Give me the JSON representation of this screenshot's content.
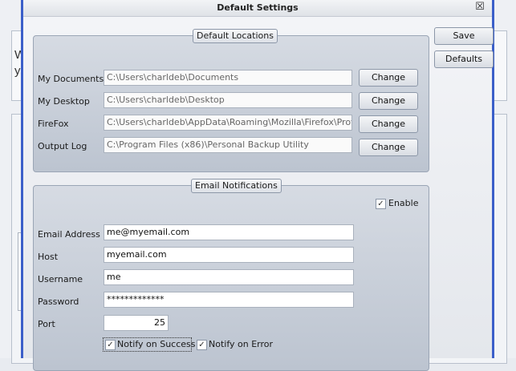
{
  "background": {
    "line1": "W",
    "line2": "y"
  },
  "dialog": {
    "title": "Default Settings",
    "close_glyph": "☒"
  },
  "side_buttons": {
    "save": "Save",
    "defaults": "Defaults"
  },
  "default_locations": {
    "title": "Default Locations",
    "change_label": "Change",
    "rows": [
      {
        "label": "My Documents",
        "value": "C:\\Users\\charldeb\\Documents"
      },
      {
        "label": "My Desktop",
        "value": "C:\\Users\\charldeb\\Desktop"
      },
      {
        "label": "FireFox",
        "value": "C:\\Users\\charldeb\\AppData\\Roaming\\Mozilla\\Firefox\\Profile"
      },
      {
        "label": "Output Log",
        "value": "C:\\Program Files (x86)\\Personal Backup Utility"
      }
    ]
  },
  "email": {
    "title": "Email Notifications",
    "enable_label": "Enable",
    "enable_checked": true,
    "fields": {
      "email_address": {
        "label": "Email Address",
        "value": "me@myemail.com"
      },
      "host": {
        "label": "Host",
        "value": "myemail.com"
      },
      "username": {
        "label": "Username",
        "value": "me"
      },
      "password": {
        "label": "Password",
        "value": "*************"
      },
      "port": {
        "label": "Port",
        "value": "25"
      }
    },
    "notify_success_label": "Notify on Success",
    "notify_success_checked": true,
    "notify_error_label": "Notify on Error",
    "notify_error_checked": true
  },
  "check_glyph": "✓"
}
